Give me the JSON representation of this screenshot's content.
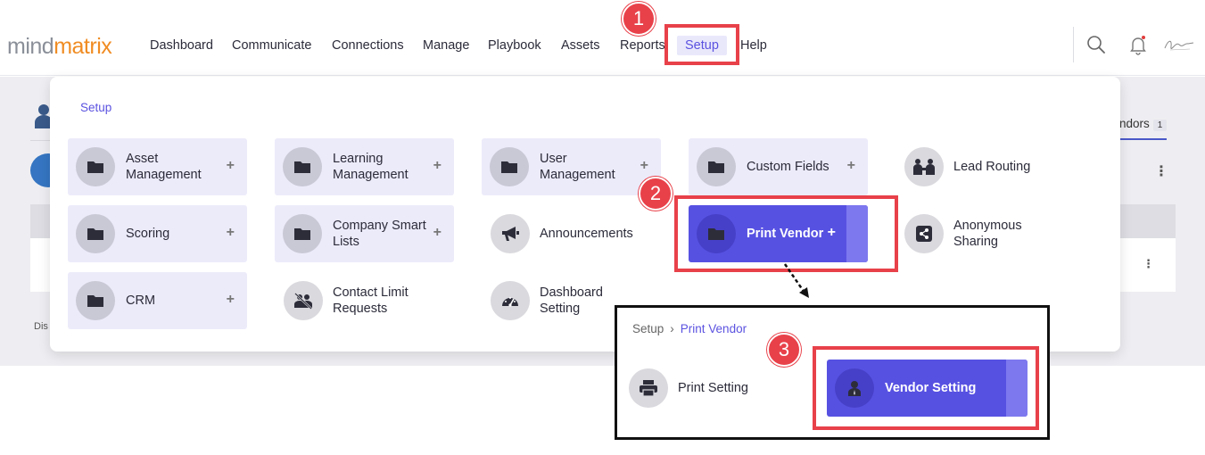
{
  "header": {
    "logo_part1": "mind",
    "logo_part2": "matrix",
    "nav": [
      {
        "label": "Dashboard"
      },
      {
        "label": "Communicate"
      },
      {
        "label": "Connections"
      },
      {
        "label": "Manage"
      },
      {
        "label": "Playbook"
      },
      {
        "label": "Assets"
      },
      {
        "label": "Reports"
      },
      {
        "label": "Setup"
      },
      {
        "label": "Help"
      }
    ],
    "icons": [
      "search-icon",
      "bell-icon",
      "signature-avatar"
    ]
  },
  "background": {
    "tab_label": "ndors",
    "tab_badge": "1",
    "footer_text": "Dis"
  },
  "setup_menu": {
    "title": "Setup",
    "tiles": [
      {
        "label": "Asset Management",
        "type": "folder",
        "plus": "+"
      },
      {
        "label": "Learning Management",
        "type": "folder",
        "plus": "+"
      },
      {
        "label": "User Management",
        "type": "folder",
        "plus": "+"
      },
      {
        "label": "Custom Fields",
        "type": "folder",
        "plus": "+"
      },
      {
        "label": "Lead Routing",
        "type": "plain"
      },
      {
        "label": "Scoring",
        "type": "folder",
        "plus": "+"
      },
      {
        "label": "Company Smart Lists",
        "type": "folder",
        "plus": "+"
      },
      {
        "label": "Announcements",
        "type": "plain"
      },
      {
        "label": "Print Vendor",
        "type": "folder",
        "plus": "+",
        "active": true
      },
      {
        "label": "Anonymous Sharing",
        "type": "plain"
      },
      {
        "label": "CRM",
        "type": "folder",
        "plus": "+"
      },
      {
        "label": "Contact Limit Requests",
        "type": "plain"
      },
      {
        "label": "Dashboard Setting",
        "type": "plain"
      }
    ]
  },
  "inset": {
    "breadcrumb_root": "Setup",
    "breadcrumb_current": "Print Vendor",
    "tiles": [
      {
        "label": "Print Setting"
      },
      {
        "label": "Vendor Setting",
        "active": true
      }
    ]
  },
  "annotations": {
    "step1": "1",
    "step2": "2",
    "step3": "3",
    "color": "#e8414a"
  },
  "colors": {
    "accent": "#5751e2",
    "tile_bg": "#ecebfa",
    "logo_orange": "#f08c23"
  }
}
